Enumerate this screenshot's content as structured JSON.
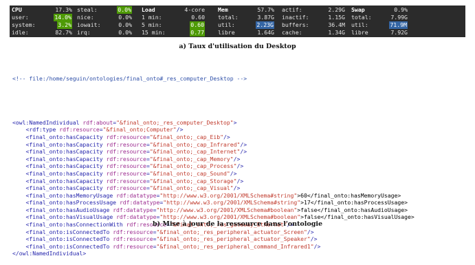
{
  "monitor": {
    "cpu": {
      "header": "CPU",
      "header_value": "17.3%",
      "rows": [
        {
          "label": "user:",
          "value": "14.0%",
          "hl": true
        },
        {
          "label": "system:",
          "value": "3.2%",
          "hl": true
        },
        {
          "label": "idle:",
          "value": "82.7%",
          "hl": false
        }
      ]
    },
    "cpu2": {
      "rows": [
        {
          "label": "steal:",
          "value": "0.0%",
          "hl": true
        },
        {
          "label": "nice:",
          "value": "0.0%",
          "hl": false
        },
        {
          "label": "iowait:",
          "value": "0.0%",
          "hl": false
        },
        {
          "label": "irq:",
          "value": "0.0%",
          "hl": false
        }
      ]
    },
    "load": {
      "header": "Load",
      "header_value": "4-core",
      "rows": [
        {
          "label": "1 min:",
          "value": "0.60",
          "hl": false
        },
        {
          "label": "5 min:",
          "value": "0.60",
          "hl": true
        },
        {
          "label": "15 min:",
          "value": "0.77",
          "hl": true
        }
      ]
    },
    "mem": {
      "header": "Mem",
      "header_value": "57.7%",
      "rows": [
        {
          "label": "total:",
          "value": "3.87G",
          "hl": false
        },
        {
          "label": "util:",
          "value": "2.23G",
          "hl": "blue"
        },
        {
          "label": "libre",
          "value": "1.64G",
          "hl": false
        }
      ]
    },
    "mem2": {
      "rows": [
        {
          "label": "actif:",
          "value": "2.29G"
        },
        {
          "label": "inactif:",
          "value": "1.15G"
        },
        {
          "label": "buffers:",
          "value": "36.4M"
        },
        {
          "label": "cache:",
          "value": "1.34G"
        }
      ]
    },
    "swap": {
      "header": "Swap",
      "header_value": "0.9%",
      "rows": [
        {
          "label": "total:",
          "value": "7.99G",
          "hl": false
        },
        {
          "label": "util:",
          "value": "71.9M",
          "hl": "blue"
        },
        {
          "label": "libre",
          "value": "7.92G",
          "hl": false
        }
      ]
    }
  },
  "caption_a": "a) Taux d'utilisation du Desktop",
  "caption_b": "b) Mise à jour de la ressource dans l'ontologie",
  "code": {
    "comment": "<!-- file:/home/seguin/ontologies/final_onto#_res_computer_Desktop -->",
    "lines": [
      [
        [
          "tag",
          "<owl:NamedIndividual "
        ],
        [
          "attr",
          "rdf:about"
        ],
        [
          "tag",
          "="
        ],
        [
          "val",
          "\"&final_onto;_res_computer_Desktop\""
        ],
        [
          "tag",
          ">"
        ]
      ],
      [
        [
          "tag",
          "    <rdf:type "
        ],
        [
          "attr",
          "rdf:resource"
        ],
        [
          "tag",
          "="
        ],
        [
          "val",
          "\"&final_onto;Computer\""
        ],
        [
          "tag",
          "/>"
        ]
      ],
      [
        [
          "tag",
          "    <final_onto:hasCapacity "
        ],
        [
          "attr",
          "rdf:resource"
        ],
        [
          "tag",
          "="
        ],
        [
          "val",
          "\"&final_onto;_cap_Eib\""
        ],
        [
          "tag",
          "/>"
        ]
      ],
      [
        [
          "tag",
          "    <final_onto:hasCapacity "
        ],
        [
          "attr",
          "rdf:resource"
        ],
        [
          "tag",
          "="
        ],
        [
          "val",
          "\"&final_onto;_cap_Infrared\""
        ],
        [
          "tag",
          "/>"
        ]
      ],
      [
        [
          "tag",
          "    <final_onto:hasCapacity "
        ],
        [
          "attr",
          "rdf:resource"
        ],
        [
          "tag",
          "="
        ],
        [
          "val",
          "\"&final_onto;_cap_Internet\""
        ],
        [
          "tag",
          "/>"
        ]
      ],
      [
        [
          "tag",
          "    <final_onto:hasCapacity "
        ],
        [
          "attr",
          "rdf:resource"
        ],
        [
          "tag",
          "="
        ],
        [
          "val",
          "\"&final_onto;_cap_Memory\""
        ],
        [
          "tag",
          "/>"
        ]
      ],
      [
        [
          "tag",
          "    <final_onto:hasCapacity "
        ],
        [
          "attr",
          "rdf:resource"
        ],
        [
          "tag",
          "="
        ],
        [
          "val",
          "\"&final_onto;_cap_Process\""
        ],
        [
          "tag",
          "/>"
        ]
      ],
      [
        [
          "tag",
          "    <final_onto:hasCapacity "
        ],
        [
          "attr",
          "rdf:resource"
        ],
        [
          "tag",
          "="
        ],
        [
          "val",
          "\"&final_onto;_cap_Sound\""
        ],
        [
          "tag",
          "/>"
        ]
      ],
      [
        [
          "tag",
          "    <final_onto:hasCapacity "
        ],
        [
          "attr",
          "rdf:resource"
        ],
        [
          "tag",
          "="
        ],
        [
          "val",
          "\"&final_onto;_cap_Storage\""
        ],
        [
          "tag",
          "/>"
        ]
      ],
      [
        [
          "tag",
          "    <final_onto:hasCapacity "
        ],
        [
          "attr",
          "rdf:resource"
        ],
        [
          "tag",
          "="
        ],
        [
          "val",
          "\"&final_onto;_cap_Visual\""
        ],
        [
          "tag",
          "/>"
        ]
      ],
      [
        [
          "tag",
          "    <final_onto:hasMemoryUsage "
        ],
        [
          "attr",
          "rdf:datatype"
        ],
        [
          "tag",
          "="
        ],
        [
          "val",
          "\"http://www.w3.org/2001/XMLSchema#string\""
        ],
        [
          "txt",
          ">60</final_onto:hasMemoryUsage>"
        ]
      ],
      [
        [
          "tag",
          "    <final_onto:hasProcessUsage "
        ],
        [
          "attr",
          "rdf:datatype"
        ],
        [
          "tag",
          "="
        ],
        [
          "val",
          "\"http://www.w3.org/2001/XMLSchema#string\""
        ],
        [
          "txt",
          ">17</final_onto:hasProcessUsage>"
        ]
      ],
      [
        [
          "tag",
          "    <final_onto:hasAudioUsage "
        ],
        [
          "attr",
          "rdf:datatype"
        ],
        [
          "tag",
          "="
        ],
        [
          "val",
          "\"http://www.w3.org/2001/XMLSchema#boolean\""
        ],
        [
          "txt",
          ">false</final_onto:hasAudioUsage>"
        ]
      ],
      [
        [
          "tag",
          "    <final_onto:hasVisualUsage "
        ],
        [
          "attr",
          "rdf:datatype"
        ],
        [
          "tag",
          "="
        ],
        [
          "val",
          "\"http://www.w3.org/2001/XMLSchema#boolean\""
        ],
        [
          "txt",
          ">false</final_onto:hasVisualUsage>"
        ]
      ],
      [
        [
          "tag",
          "    <final_onto:hasConnectionWith "
        ],
        [
          "attr",
          "rdf:resource"
        ],
        [
          "tag",
          "="
        ],
        [
          "val",
          "\"&final_onto;_res_gateway_Ethernet\""
        ],
        [
          "tag",
          "/>"
        ]
      ],
      [
        [
          "tag",
          "    <final_onto:isConnectedTo "
        ],
        [
          "attr",
          "rdf:resource"
        ],
        [
          "tag",
          "="
        ],
        [
          "val",
          "\"&final_onto;_res_peripheral_actuator_Screen\""
        ],
        [
          "tag",
          "/>"
        ]
      ],
      [
        [
          "tag",
          "    <final_onto:isConnectedTo "
        ],
        [
          "attr",
          "rdf:resource"
        ],
        [
          "tag",
          "="
        ],
        [
          "val",
          "\"&final_onto;_res_peripheral_actuator_Speaker\""
        ],
        [
          "tag",
          "/>"
        ]
      ],
      [
        [
          "tag",
          "    <final_onto:isConnectedTo "
        ],
        [
          "attr",
          "rdf:resource"
        ],
        [
          "tag",
          "="
        ],
        [
          "val",
          "\"&final_onto;_res_peripheral_command_Infrared1\""
        ],
        [
          "tag",
          "/>"
        ]
      ],
      [
        [
          "tag",
          "</owl:NamedIndividual>"
        ]
      ]
    ]
  }
}
